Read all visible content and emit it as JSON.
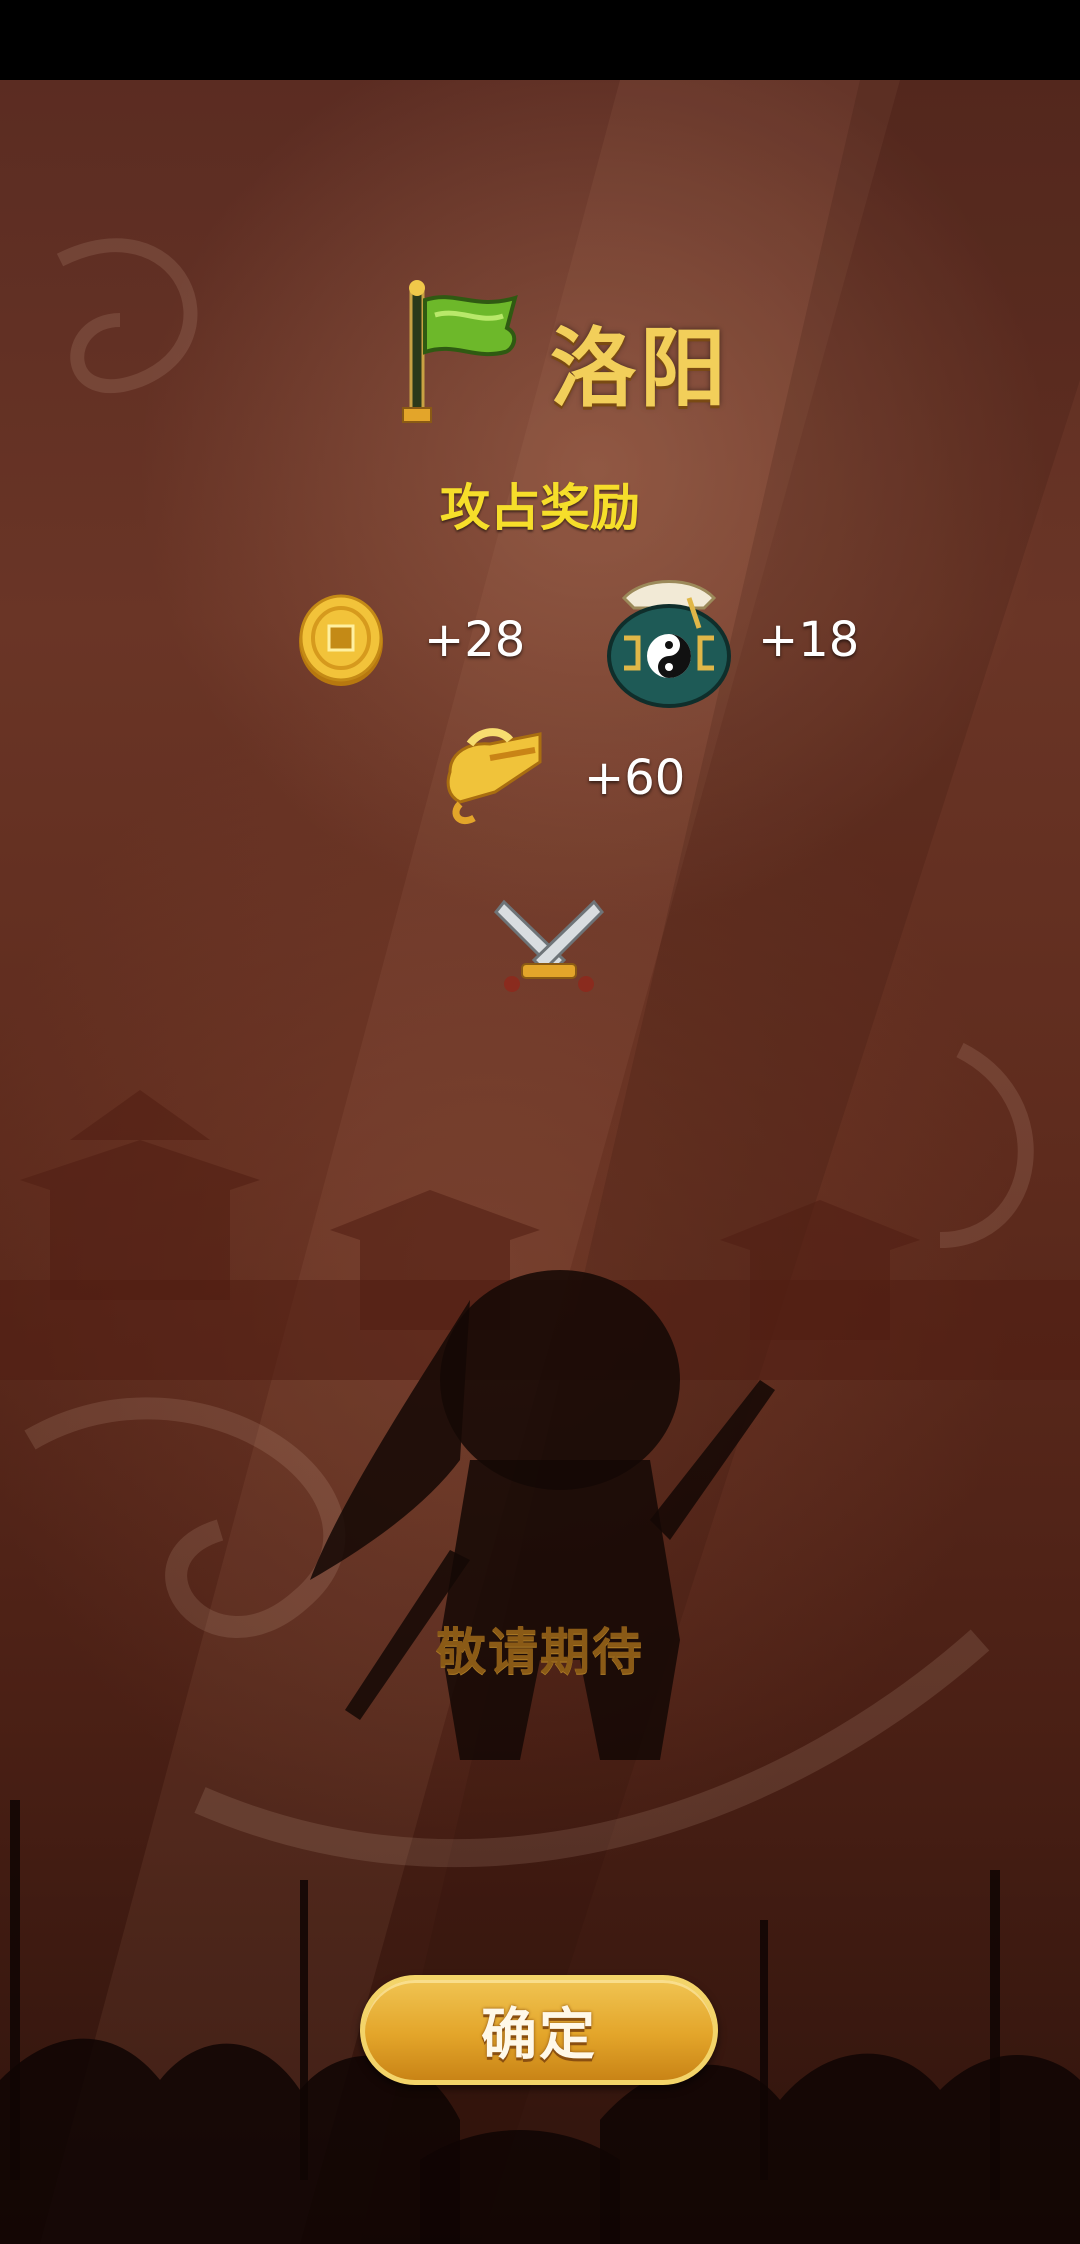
{
  "city": {
    "name": "洛阳",
    "flag_icon": "green-flag-icon"
  },
  "rewards": {
    "title": "攻占奖励",
    "items": [
      {
        "icon": "gold-coin-icon",
        "amount": "+28"
      },
      {
        "icon": "taiji-jar-icon",
        "amount": "+18"
      },
      {
        "icon": "gold-ingot-icon",
        "amount": "+60"
      }
    ],
    "bonus_icon": "crossed-swords-icon"
  },
  "character": {
    "caption": "敬请期待"
  },
  "confirm_button": {
    "label": "确定"
  },
  "colors": {
    "city_name": "#f2cf5a",
    "reward_title": "#f6de2a",
    "button": "#e3a52a",
    "background": "#5a2a1e"
  }
}
